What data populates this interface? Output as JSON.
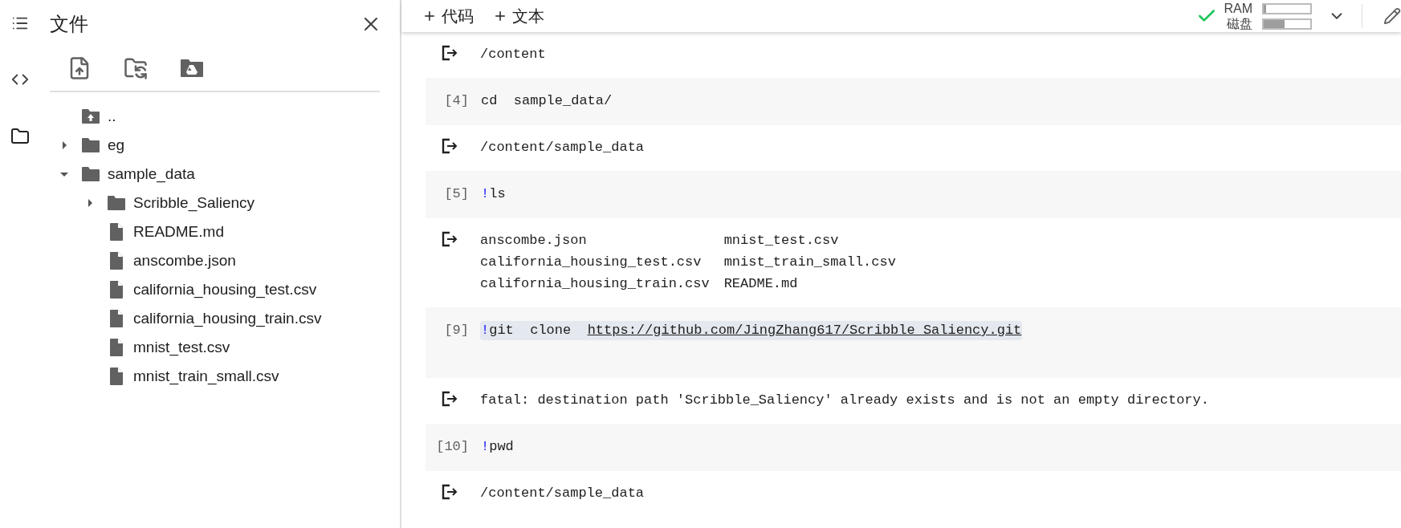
{
  "files_panel": {
    "title": "文件",
    "tree": [
      {
        "name": "..",
        "kind": "parent"
      },
      {
        "name": "eg",
        "kind": "folder",
        "expanded": false
      },
      {
        "name": "sample_data",
        "kind": "folder",
        "expanded": true,
        "children": [
          {
            "name": "Scribble_Saliency",
            "kind": "folder",
            "expanded": false
          },
          {
            "name": "README.md",
            "kind": "file"
          },
          {
            "name": "anscombe.json",
            "kind": "file"
          },
          {
            "name": "california_housing_test.csv",
            "kind": "file"
          },
          {
            "name": "california_housing_train.csv",
            "kind": "file"
          },
          {
            "name": "mnist_test.csv",
            "kind": "file"
          },
          {
            "name": "mnist_train_small.csv",
            "kind": "file"
          }
        ]
      }
    ]
  },
  "toolbar": {
    "buttons": [
      "代码",
      "文本"
    ],
    "resources": [
      {
        "label": "RAM",
        "level": 0.05
      },
      {
        "label": "磁盘",
        "level": 0.45
      }
    ]
  },
  "cells": [
    {
      "kind": "output",
      "lines": [
        "/content"
      ]
    },
    {
      "kind": "code",
      "prompt": "[4]",
      "highlighted": false,
      "code": [
        {
          "kind": "plain",
          "text": "cd  sample_data/"
        }
      ]
    },
    {
      "kind": "output",
      "lines": [
        "/content/sample_data"
      ]
    },
    {
      "kind": "code",
      "prompt": "[5]",
      "highlighted": false,
      "code": [
        {
          "kind": "magic",
          "text": "!"
        },
        {
          "kind": "plain",
          "text": "ls"
        }
      ]
    },
    {
      "kind": "listing",
      "rows": [
        [
          "anscombe.json",
          "mnist_test.csv"
        ],
        [
          "california_housing_test.csv",
          "mnist_train_small.csv"
        ],
        [
          "california_housing_train.csv",
          "README.md"
        ]
      ]
    },
    {
      "kind": "code",
      "prompt": "[9]",
      "highlighted": true,
      "code": [
        {
          "kind": "magic",
          "text": "!"
        },
        {
          "kind": "plain",
          "text": "git  clone  "
        },
        {
          "kind": "link",
          "text": "https://github.com/JingZhang617/Scribble_Saliency.git"
        }
      ]
    },
    {
      "kind": "output",
      "lines": [
        "fatal: destination path 'Scribble_Saliency' already exists and is not an empty directory."
      ]
    },
    {
      "kind": "code",
      "prompt": "[10]",
      "highlighted": false,
      "code": [
        {
          "kind": "magic",
          "text": "!"
        },
        {
          "kind": "plain",
          "text": "pwd"
        }
      ]
    },
    {
      "kind": "output",
      "lines": [
        "/content/sample_data"
      ]
    }
  ]
}
